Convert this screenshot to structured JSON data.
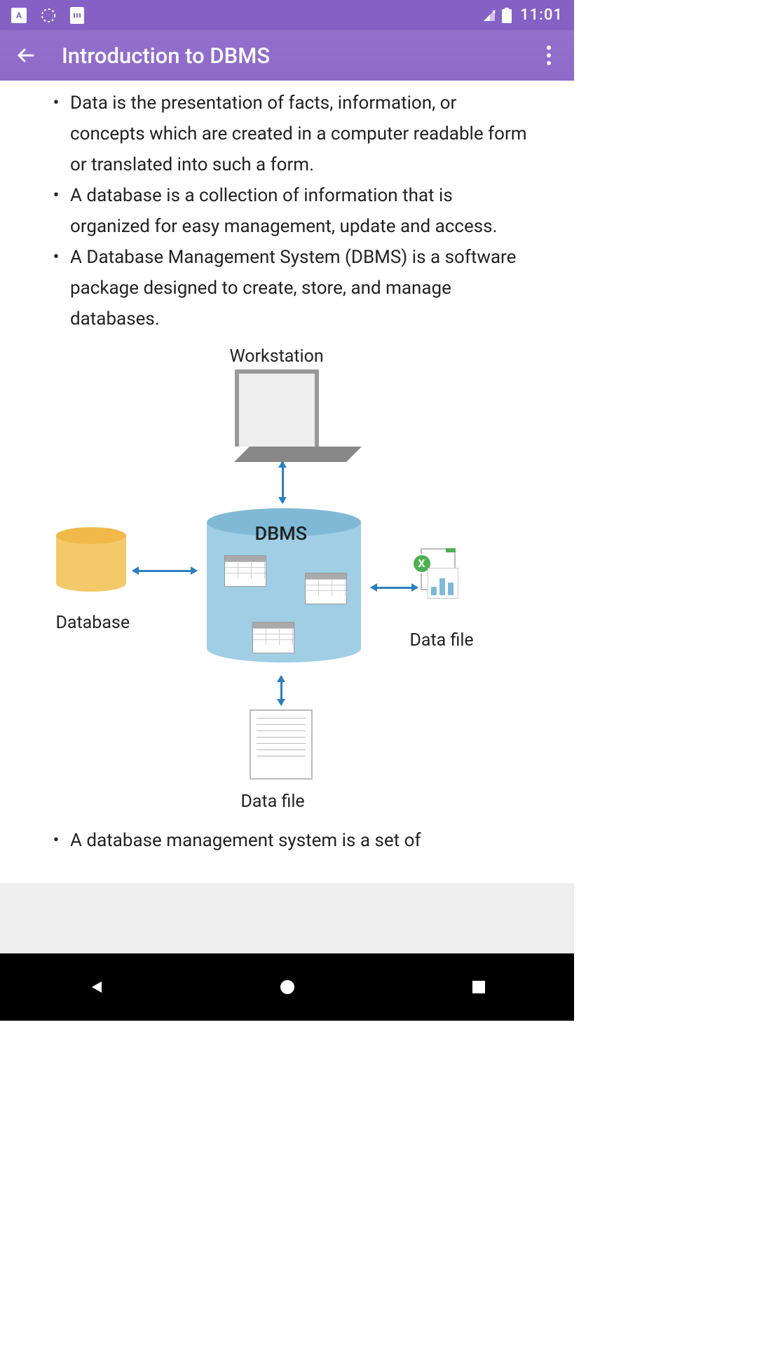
{
  "status": {
    "time": "11:01",
    "icons": {
      "a": "A",
      "sd": "SD"
    }
  },
  "appbar": {
    "title": "Introduction to DBMS"
  },
  "bullets": [
    "Data is the presentation of facts, information, or concepts which are created in a computer readable form or translated into such a form.",
    "A database is a collection of information that is organized for easy management, update and access.",
    "A Database Management System (DBMS) is a software package designed to create, store, and manage databases."
  ],
  "bullets2": [
    "A database management system is a set of"
  ],
  "diagram": {
    "workstation": "Workstation",
    "dbms": "DBMS",
    "database": "Database",
    "datafile_right": "Data file",
    "datafile_bottom": "Data file",
    "x_badge": "X"
  }
}
